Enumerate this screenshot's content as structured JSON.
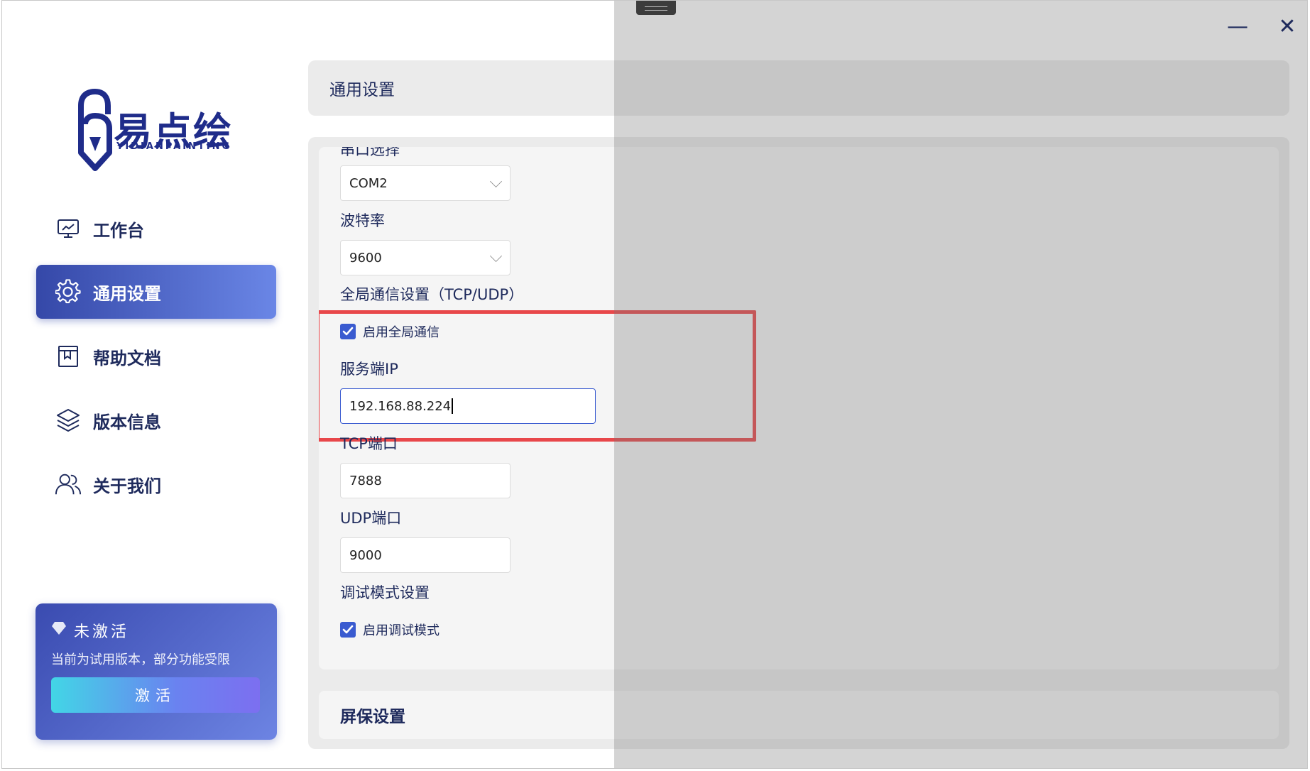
{
  "window": {
    "minimize_glyph": "—",
    "close_glyph": "✕"
  },
  "logo": {
    "cn": "易点绘",
    "en": "YIDIANPAINTING"
  },
  "sidebar": {
    "items": [
      {
        "label": "工作台",
        "icon": "monitor-icon",
        "active": false
      },
      {
        "label": "通用设置",
        "icon": "gear-icon",
        "active": true
      },
      {
        "label": "帮助文档",
        "icon": "book-icon",
        "active": false
      },
      {
        "label": "版本信息",
        "icon": "layers-icon",
        "active": false
      },
      {
        "label": "关于我们",
        "icon": "users-icon",
        "active": false
      }
    ]
  },
  "activation": {
    "status": "未激活",
    "note": "当前为试用版本，部分功能受限",
    "button": "激活",
    "icon": "diamond-icon"
  },
  "main": {
    "title": "通用设置",
    "serial_port": {
      "label": "串口选择",
      "value": "COM2"
    },
    "baud_rate": {
      "label": "波特率",
      "value": "9600"
    },
    "global_comm": {
      "section": "全局通信设置（TCP/UDP）",
      "enable_label": "启用全局通信",
      "enabled": true,
      "server_ip_label": "服务端IP",
      "server_ip": "192.168.88.224",
      "tcp_label": "TCP端口",
      "tcp_port": "7888",
      "udp_label": "UDP端口",
      "udp_port": "9000"
    },
    "debug": {
      "section": "调试模式设置",
      "enable_label": "启用调试模式",
      "enabled": true
    },
    "screensaver": {
      "title": "屏保设置"
    }
  },
  "colors": {
    "accent": "#3a5bd0",
    "highlight": "#e8474a",
    "text": "#1e2a5c"
  }
}
